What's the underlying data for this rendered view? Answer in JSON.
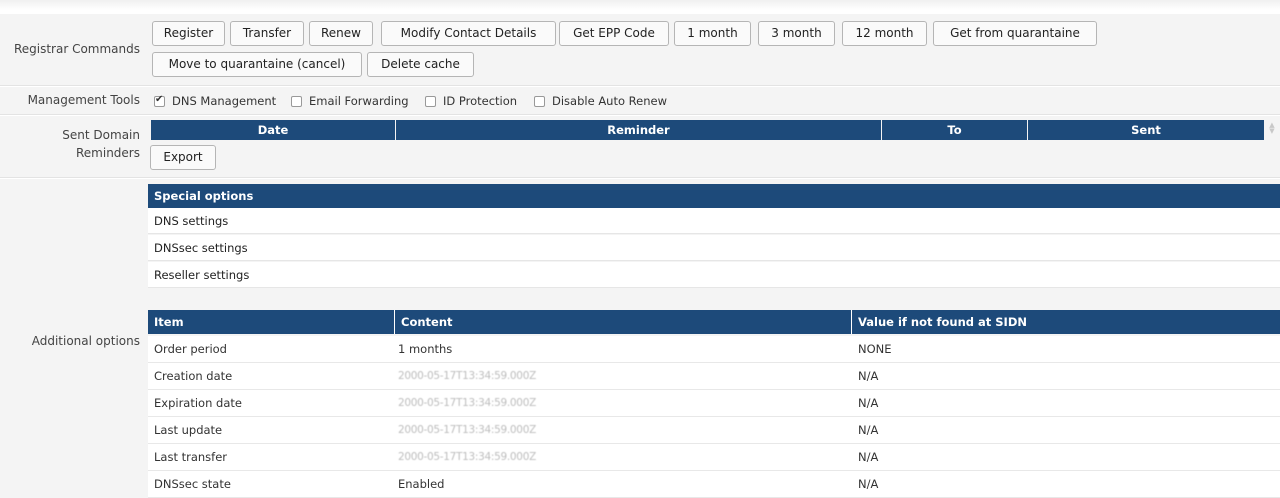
{
  "registrar": {
    "label": "Registrar Commands",
    "buttons_row1": [
      "Register",
      "Transfer",
      "Renew",
      "Modify Contact Details",
      "Get EPP Code",
      "1 month",
      "3 month",
      "12 month",
      "Get from quarantaine"
    ],
    "buttons_row2": [
      "Move to quarantaine (cancel)",
      "Delete cache"
    ]
  },
  "management": {
    "label": "Management Tools",
    "options": [
      {
        "label": "DNS Management",
        "checked": true
      },
      {
        "label": "Email Forwarding",
        "checked": false
      },
      {
        "label": "ID Protection",
        "checked": false
      },
      {
        "label": "Disable Auto Renew",
        "checked": false
      }
    ]
  },
  "reminders": {
    "label_line1": "Sent Domain",
    "label_line2": "Reminders",
    "columns": [
      "Date",
      "Reminder",
      "To",
      "Sent"
    ],
    "export_label": "Export"
  },
  "additional": {
    "label": "Additional options",
    "special_header": "Special options",
    "special_items": [
      "DNS settings",
      "DNSsec settings",
      "Reseller settings"
    ],
    "columns": [
      "Item",
      "Content",
      "Value if not found at SIDN"
    ],
    "rows": [
      {
        "item": "Order period",
        "content": "1 months",
        "value": "NONE",
        "blurred": false
      },
      {
        "item": "Creation date",
        "content": "2000-05-17T13:34:59.000Z",
        "value": "N/A",
        "blurred": true
      },
      {
        "item": "Expiration date",
        "content": "2000-05-17T13:34:59.000Z",
        "value": "N/A",
        "blurred": true
      },
      {
        "item": "Last update",
        "content": "2000-05-17T13:34:59.000Z",
        "value": "N/A",
        "blurred": true
      },
      {
        "item": "Last transfer",
        "content": "2000-05-17T13:34:59.000Z",
        "value": "N/A",
        "blurred": true
      },
      {
        "item": "DNSsec state",
        "content": "Enabled",
        "value": "N/A",
        "blurred": false
      }
    ]
  },
  "colors": {
    "header_bg": "#1d4a7a",
    "panel_bg": "#f4f4f4"
  }
}
